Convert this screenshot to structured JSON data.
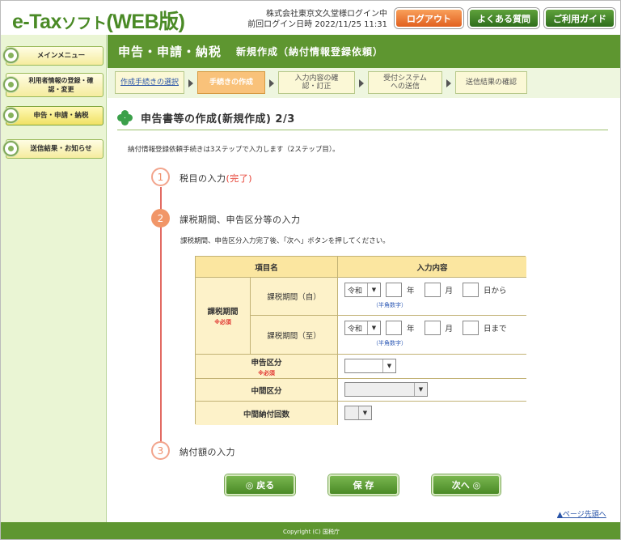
{
  "header": {
    "logo_main": "e-Tax",
    "logo_small": "ソフト",
    "logo_web": "(WEB版)",
    "login_user": "株式会社東京文久堂様ログイン中",
    "last_login": "前回ログイン日時 2022/11/25 11:31",
    "logout_label": "ログアウト",
    "faq_label": "よくある質問",
    "guide_label": "ご利用ガイド"
  },
  "sidebar": {
    "items": [
      {
        "label": "メインメニュー"
      },
      {
        "label": "利用者情報の登録・確認・変更"
      },
      {
        "label": "申告・申請・納税"
      },
      {
        "label": "送信結果・お知らせ"
      }
    ]
  },
  "title_bar": {
    "main": "申告・申請・納税",
    "sub": "新規作成（納付情報登録依頼）"
  },
  "steps": [
    {
      "label": "作成手続きの選択"
    },
    {
      "label": "手続きの作成"
    },
    {
      "label": "入力内容の確認・訂正"
    },
    {
      "label": "受付システムへの送信"
    },
    {
      "label": "送信結果の確認"
    }
  ],
  "page": {
    "title": "申告書等の作成(新規作成) 2/3",
    "intro": "納付情報登録依頼手続きは3ステップで入力します（2ステップ目）。"
  },
  "flow": {
    "step1": {
      "num": "1",
      "label": "税目の入力",
      "done": "(完了)"
    },
    "step2": {
      "num": "2",
      "label": "課税期間、申告区分等の入力",
      "instruction": "課税期間、申告区分入力完了後、「次へ」ボタンを押してください。"
    },
    "step3": {
      "num": "3",
      "label": "納付額の入力"
    }
  },
  "form": {
    "col_item": "項目名",
    "col_input": "入力内容",
    "period_group": "課税期間",
    "required": "※必須",
    "period_from": "課税期間（自）",
    "period_to": "課税期間（至）",
    "era_value": "令和",
    "year_unit": "年",
    "month_unit": "月",
    "from_suffix": "日から",
    "to_suffix": "日まで",
    "halfwidth_note": "（半角数字）",
    "declaration_type": "申告区分",
    "interim_type": "中間区分",
    "interim_count": "中間納付回数"
  },
  "buttons": {
    "back": "◎ 戻る",
    "save": "保 存",
    "next": "次へ ◎"
  },
  "page_top": "ページ先頭へ",
  "footer": "Copyright (C) 国税庁"
}
